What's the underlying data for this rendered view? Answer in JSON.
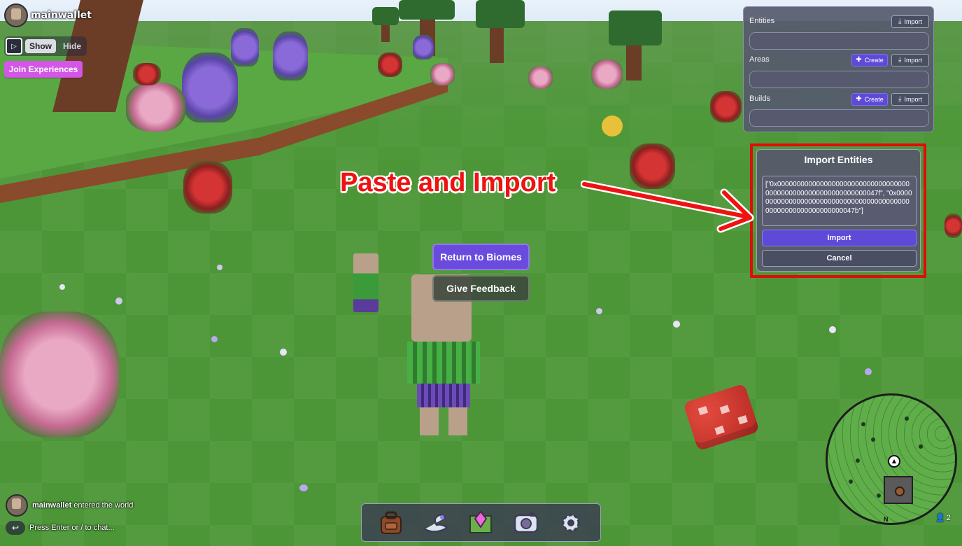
{
  "hud": {
    "player_name": "mainwallet",
    "show_label": "Show",
    "hide_label": "Hide",
    "join_experiences_label": "Join Experiences"
  },
  "center": {
    "return_label": "Return to Biomes",
    "feedback_label": "Give Feedback"
  },
  "side_panel": {
    "entities_label": "Entities",
    "areas_label": "Areas",
    "builds_label": "Builds",
    "import_label": "Import",
    "create_label": "Create"
  },
  "import_dialog": {
    "title": "Import Entities",
    "textarea_value": "[\"0x000000000000000000000000000000000000000000000000000000000000047f\", \"0x0000000000000000000000000000000000000000000000000000000000000047b\"]",
    "import_label": "Import",
    "cancel_label": "Cancel"
  },
  "annotation": {
    "text": "Paste and Import"
  },
  "toolbar": {
    "items": [
      "backpack-icon",
      "saddle-icon",
      "map-icon",
      "camera-icon",
      "gear-icon"
    ]
  },
  "chat": {
    "user": "mainwallet",
    "message": "entered the world",
    "input_placeholder": "Press Enter or / to chat..."
  },
  "minimap": {
    "north_label": "N",
    "player_count": "2"
  },
  "colors": {
    "accent_purple": "#6a4bde",
    "join_magenta": "#d456e6",
    "annotation_red": "#e30a0a",
    "panel_bg": "#565a6c"
  }
}
